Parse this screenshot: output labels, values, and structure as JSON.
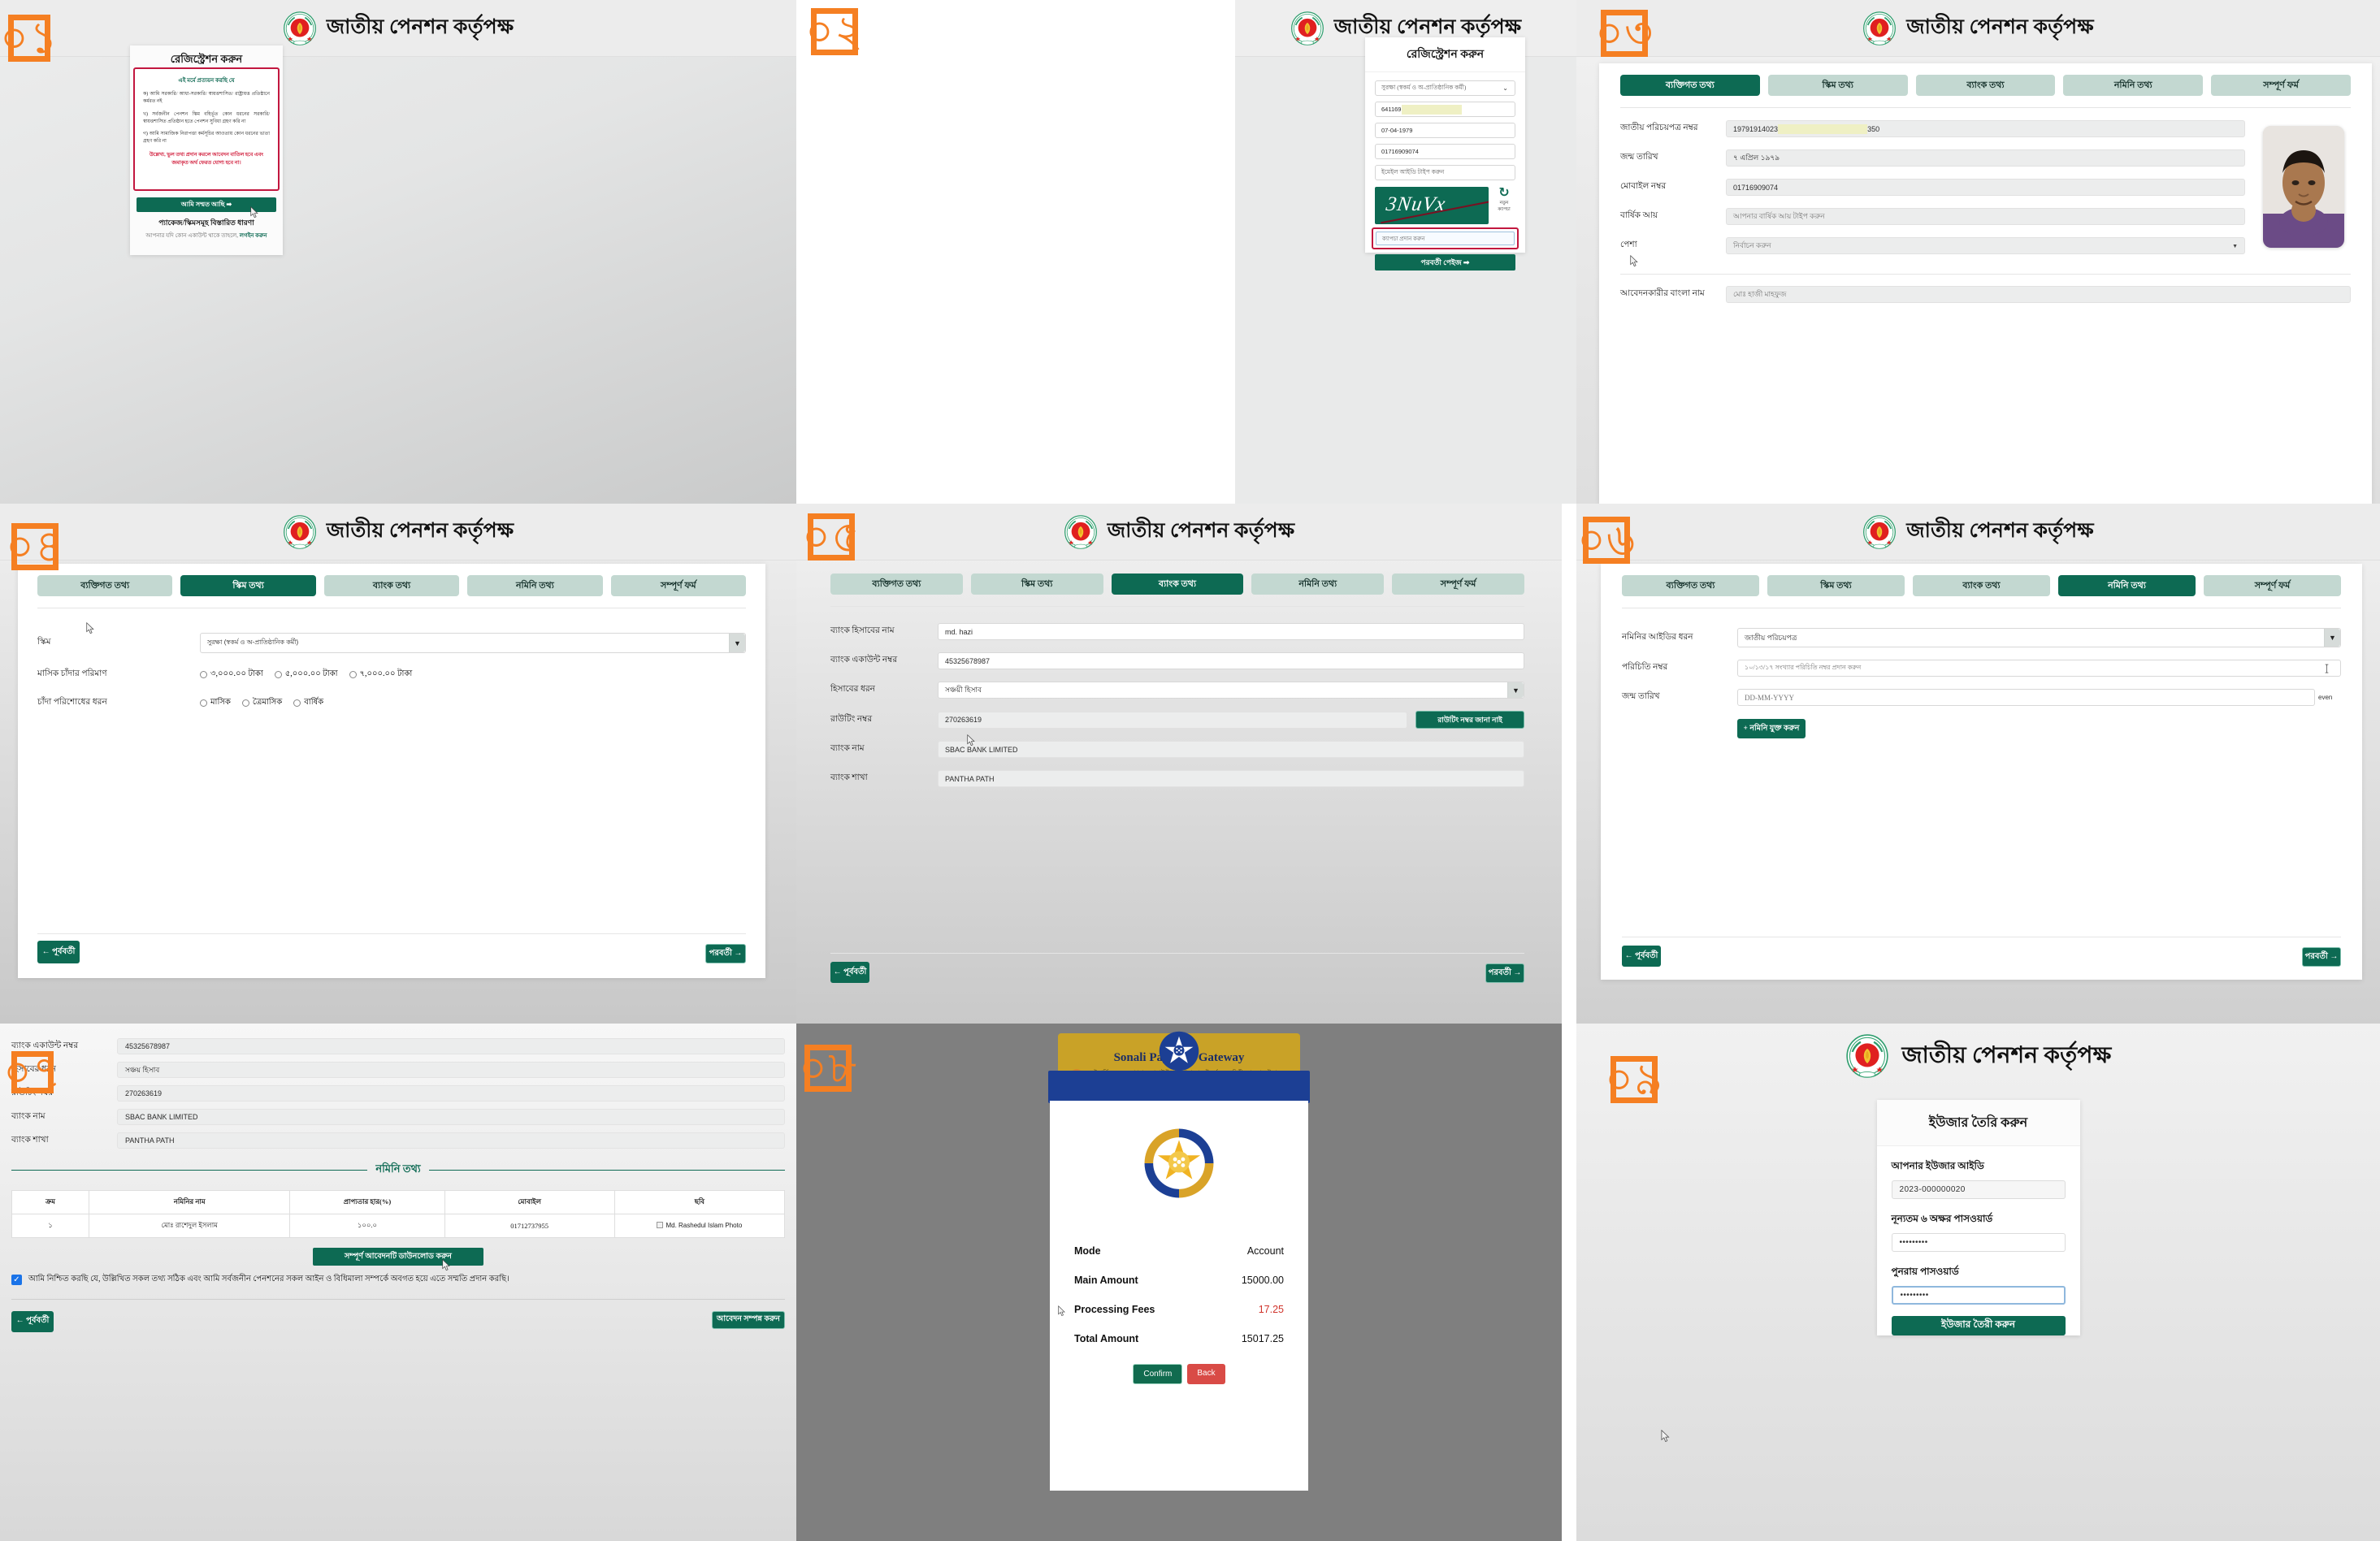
{
  "brand": {
    "title": "জাতীয় পেনশন কর্তৃপক্ষ",
    "emblem_icon": "bangladesh-govt-emblem-icon"
  },
  "step_badges": [
    "০১",
    "০২",
    "০৩",
    "০৪",
    "০৫",
    "০৬",
    "০৭",
    "০৮",
    "০৯"
  ],
  "colors": {
    "primary_green": "#0d6a53",
    "tab_inactive": "#c3d8d1",
    "alert_red": "#c2173f",
    "badge_orange": "#f57f22",
    "highlight_yellow": "#eff0c4",
    "sonali_gold": "#c9a227",
    "sonali_blue": "#1c3f94"
  },
  "panel01": {
    "card_title": "রেজিস্ট্রেশন করুন",
    "declaration_heading": "এই মর্মে প্রত্যয়ন করছি যে",
    "declaration_points": [
      "ক)  আমি  সরকারি/  আধা-সরকারি/  স্বায়ত্তশাসিত/  রাষ্ট্রায়ত্ত প্রতিষ্ঠানে কর্মরত নই",
      "খ)  সর্বজনীন  পেনশন  স্কিম  বহির্ভূত  কোন  ধরনের  সরকারি/ স্বায়ত্তশাসিত প্রতিষ্ঠান হতে পেনশন সুবিধা গ্রহণ করি না",
      "গ)  আমি  সামাজিক  নিরাপত্তা  কর্মসূচির  আওতায়  কোন  ধরনের ভাতা গ্রহণ করি না"
    ],
    "warning": "উল্লেখ্য, ভুল তথ্য প্রদান করলে আবেদন বাতিল হবে এবং জমাকৃত অর্থ ফেরত যোগ্য হবে না।",
    "agree_button": "আমি সম্মত আছি ➡",
    "package_link": "প্যাকেজ/স্কিমসমূহ বিস্তারিত ধারণা",
    "login_prefix": "আপনার যদি কোন একাউন্ট থাকে তাহলে, ",
    "login_link": "লগইন করুন"
  },
  "panel02": {
    "card_title": "রেজিস্ট্রেশন করুন",
    "scheme_select": "সুরক্ষা (স্বকর্ম ও অ-প্রাতিষ্ঠানিক কর্মী)",
    "nid_value": "641169",
    "nid_redacted": true,
    "dob_value": "07-04-1979",
    "mobile_value": "01716909074",
    "email_placeholder": "ইমেইল আইডি টাইপ করুন",
    "captcha_text": "3NuVx",
    "refresh_icon": "refresh-captcha-icon",
    "refresh_label_line1": "নতুন",
    "refresh_label_line2": "ক্যাপচা",
    "captcha_input_placeholder": "ক্যাপচা প্রদান করুন",
    "next_button": "পরবর্তী পেইজ ➡"
  },
  "tabs": [
    "ব্যক্তিগত তথ্য",
    "স্কিম তথ্য",
    "ব্যাংক তথ্য",
    "নমিনি তথ্য",
    "সম্পূর্ণ ফর্ম"
  ],
  "nav": {
    "prev": "← পূর্ববর্তী",
    "next": "পরবর্তী →"
  },
  "panel03": {
    "active_tab": 0,
    "fields": [
      {
        "label": "জাতীয় পরিচয়পত্র নম্বর",
        "value_prefix": "19791914023",
        "value_suffix": "350",
        "redacted": true
      },
      {
        "label": "জন্ম তারিখ",
        "value": "৭ এপ্রিল ১৯৭৯"
      },
      {
        "label": "মোবাইল নম্বর",
        "value": "01716909074"
      },
      {
        "label": "বার্ষিক আয়",
        "value": "আপনার বার্ষিক আয় টাইপ করুন",
        "placeholder": true
      },
      {
        "label": "পেশা",
        "value": "নির্বাচন করুন",
        "select": true
      },
      {
        "label": "আবেদনকারীর বাংলা নাম",
        "value": "মোঃ হাজী মাহফুজ"
      }
    ],
    "photo_alt": "applicant-photo"
  },
  "panel04": {
    "active_tab": 1,
    "scheme_label": "স্কিম",
    "scheme_value": "সুরক্ষা (স্বকর্ম ও অ-প্রাতিষ্ঠানিক কর্মী)",
    "contribution_label": "মাসিক চাঁদার পরিমাণ",
    "contribution_options": [
      "৩,০০০.০০ টাকা",
      "৫,০০০.০০ টাকা",
      "৭,০০০.০০ টাকা"
    ],
    "frequency_label": "চাঁদা পরিশোধের ধরন",
    "frequency_options": [
      "মাসিক",
      "ত্রৈমাসিক",
      "বার্ষিক"
    ]
  },
  "panel05": {
    "active_tab": 2,
    "fields": [
      {
        "label": "ব্যাংক হিসাবের নাম",
        "value": "md. hazi"
      },
      {
        "label": "ব্যাংক একাউন্ট নম্বর",
        "value": "45325678987"
      },
      {
        "label": "হিসাবের ধরন",
        "value": "সঞ্চয়ী হিসাব",
        "select": true
      },
      {
        "label": "রাউটিং নম্বর",
        "value": "270263619",
        "readonly": true
      },
      {
        "label": "ব্যাংক নাম",
        "value": "SBAC BANK LIMITED",
        "readonly": true
      },
      {
        "label": "ব্যাংক শাখা",
        "value": "PANTHA PATH",
        "readonly": true
      }
    ],
    "routing_help_button": "রাউটিং নম্বর জানা নাই"
  },
  "panel06": {
    "active_tab": 3,
    "id_type_label": "নমিনির আইডির ধরন",
    "id_type_value": "জাতীয় পরিচয়পত্র",
    "id_number_label": "পরিচিতি নম্বর",
    "id_number_placeholder": "১০/১৩/১৭ সংখ্যার পরিচিতি নম্বর প্রদান করুন",
    "dob_label": "জন্ম তারিখ",
    "dob_placeholder": "DD-MM-YYYY",
    "dob_side_text": "even",
    "add_nominee_button": "+ নমিনি যুক্ত করুন"
  },
  "panel07": {
    "fields": [
      {
        "label": "ব্যাংক একাউন্ট নম্বর",
        "value": "45325678987"
      },
      {
        "label": "হিসাবের ধরন",
        "value": "সঞ্চয় হিসাব"
      },
      {
        "label": "রাউটিং নম্বর",
        "value": "270263619"
      },
      {
        "label": "ব্যাংক নাম",
        "value": "SBAC BANK LIMITED"
      },
      {
        "label": "ব্যাংক শাখা",
        "value": "PANTHA PATH"
      }
    ],
    "section_title": "নমিনি তথ্য",
    "table_headers": [
      "ক্রম",
      "নমিনির নাম",
      "প্রাপ্যতার হার(%)",
      "মোবাইল",
      "ছবি"
    ],
    "table_rows": [
      {
        "sl": "১",
        "name": "মোঃ রাশেদুল ইসলাম",
        "rate": "১০০.০",
        "mobile": "01712737955",
        "photo_alt": "Md. Rashedul Islam Photo"
      }
    ],
    "download_button": "সম্পূর্ণ আবেদনটি ডাউনলোড করুন",
    "consent_checked": true,
    "consent_text": "আমি নিশ্চিত করছি যে, উল্লিখিত সকল তথ্য সঠিক এবং আমি সর্বজনীন পেনশনের সকল আইন ও বিধিমালা সম্পর্কে অবগত হয়ে এতে সম্মতি প্রদান করছি।",
    "prev_button": "← পূর্ববর্তী",
    "submit_button": "আবেদন সম্পন্ন করুন"
  },
  "panel08": {
    "gateway_title": "Sonali Payment Gateway",
    "gateway_icon": "sonali-bank-logo-icon",
    "info_icon": "info-icon",
    "notice": "একই সার্ভিসের জন্য আপনার অ্যাকাউন্ট থেকে টাকা পেমেন্ট/কর্তন হলে দ্বিতীয় বার পেমেন্ট না করার জন্য অনুরোধ করা হচ্ছে।",
    "rows": [
      {
        "key": "Mode",
        "value": "Account",
        "red": false
      },
      {
        "key": "Main Amount",
        "value": "15000.00",
        "red": false
      },
      {
        "key": "Processing Fees",
        "value": "17.25",
        "red": true
      },
      {
        "key": "Total Amount",
        "value": "15017.25",
        "red": false
      }
    ],
    "confirm_button": "Confirm",
    "back_button": "Back"
  },
  "panel09": {
    "card_title": "ইউজার তৈরি করুন",
    "userid_label": "আপনার ইউজার আইডি",
    "userid_value": "2023-000000020",
    "password_label": "নূন্যতম ৬ অক্ষর পাসওয়ার্ড",
    "password_value": "•••••••••",
    "confirm_label": "পুনরায় পাসওয়ার্ড",
    "confirm_value": "•••••••••",
    "submit_button": "ইউজার তৈরী করুন"
  }
}
